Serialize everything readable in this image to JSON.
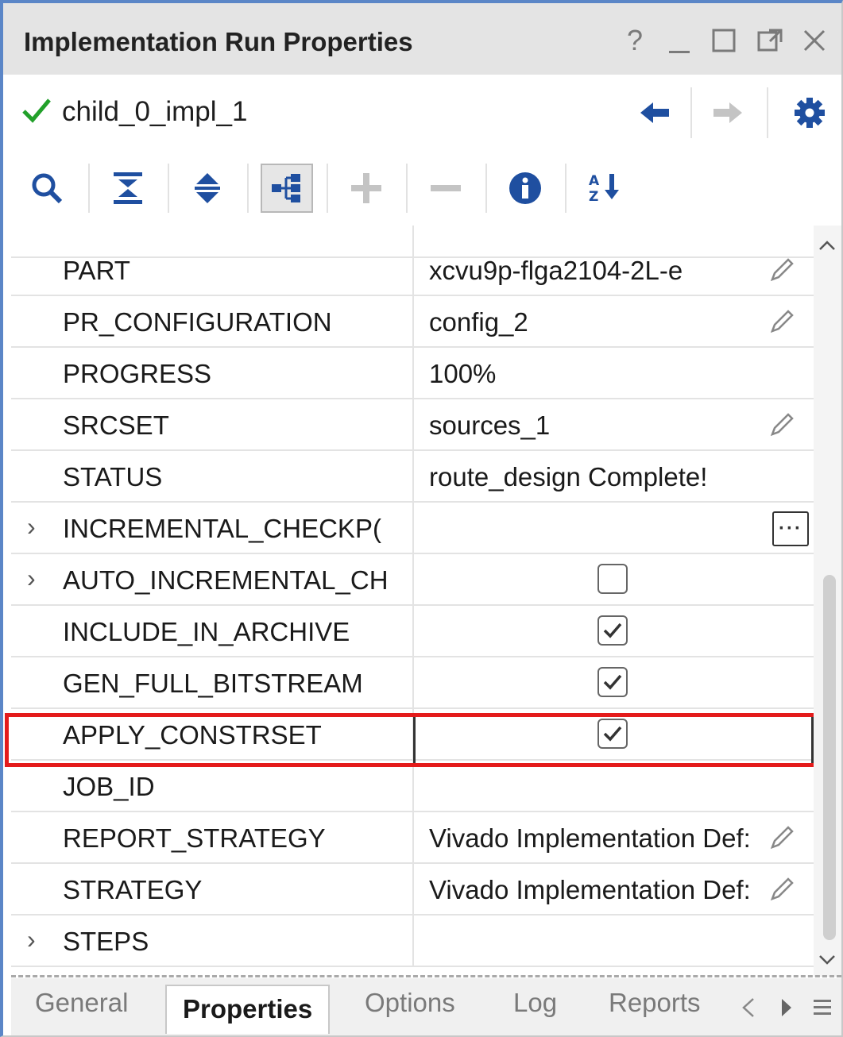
{
  "window": {
    "title": "Implementation Run Properties",
    "help_label": "?",
    "minimize_label": "_"
  },
  "run": {
    "name": "child_0_impl_1",
    "status_icon": "check-icon",
    "check_color": "#22a02a"
  },
  "toolbar": {
    "icons": [
      "search-icon",
      "collapse-all-icon",
      "expand-all-icon",
      "group-by-category-icon",
      "add-icon",
      "remove-icon",
      "info-icon",
      "sort-alpha-icon"
    ]
  },
  "properties": [
    {
      "name": "PART",
      "value": "xcvu9p-flga2104-2L-e",
      "editable": true
    },
    {
      "name": "PR_CONFIGURATION",
      "value": "config_2",
      "editable": true
    },
    {
      "name": "PROGRESS",
      "value": "100%",
      "editable": false
    },
    {
      "name": "SRCSET",
      "value": "sources_1",
      "editable": true
    },
    {
      "name": "STATUS",
      "value": "route_design Complete!",
      "editable": false
    },
    {
      "name": "INCREMENTAL_CHECKP(",
      "value": "",
      "expandable": true,
      "browse": true
    },
    {
      "name": "AUTO_INCREMENTAL_CH",
      "value": "",
      "expandable": true,
      "checkbox": true,
      "checked": false
    },
    {
      "name": "INCLUDE_IN_ARCHIVE",
      "value": "",
      "checkbox": true,
      "checked": true
    },
    {
      "name": "GEN_FULL_BITSTREAM",
      "value": "",
      "checkbox": true,
      "checked": true
    },
    {
      "name": "APPLY_CONSTRSET",
      "value": "",
      "checkbox": true,
      "checked": true,
      "highlighted": true
    },
    {
      "name": "JOB_ID",
      "value": "",
      "editable": false
    },
    {
      "name": "REPORT_STRATEGY",
      "value": "Vivado Implementation Def:",
      "editable": true
    },
    {
      "name": "STRATEGY",
      "value": "Vivado Implementation Def:",
      "editable": true
    },
    {
      "name": "STEPS",
      "value": "",
      "expandable": true
    }
  ],
  "tabs": {
    "general": "General",
    "properties": "Properties",
    "options": "Options",
    "log": "Log",
    "reports": "Reports",
    "active": "Properties"
  },
  "colors": {
    "highlight": "#e41b1b",
    "accent_border": "#5b86c7",
    "icon_blue": "#1f4fa0"
  }
}
